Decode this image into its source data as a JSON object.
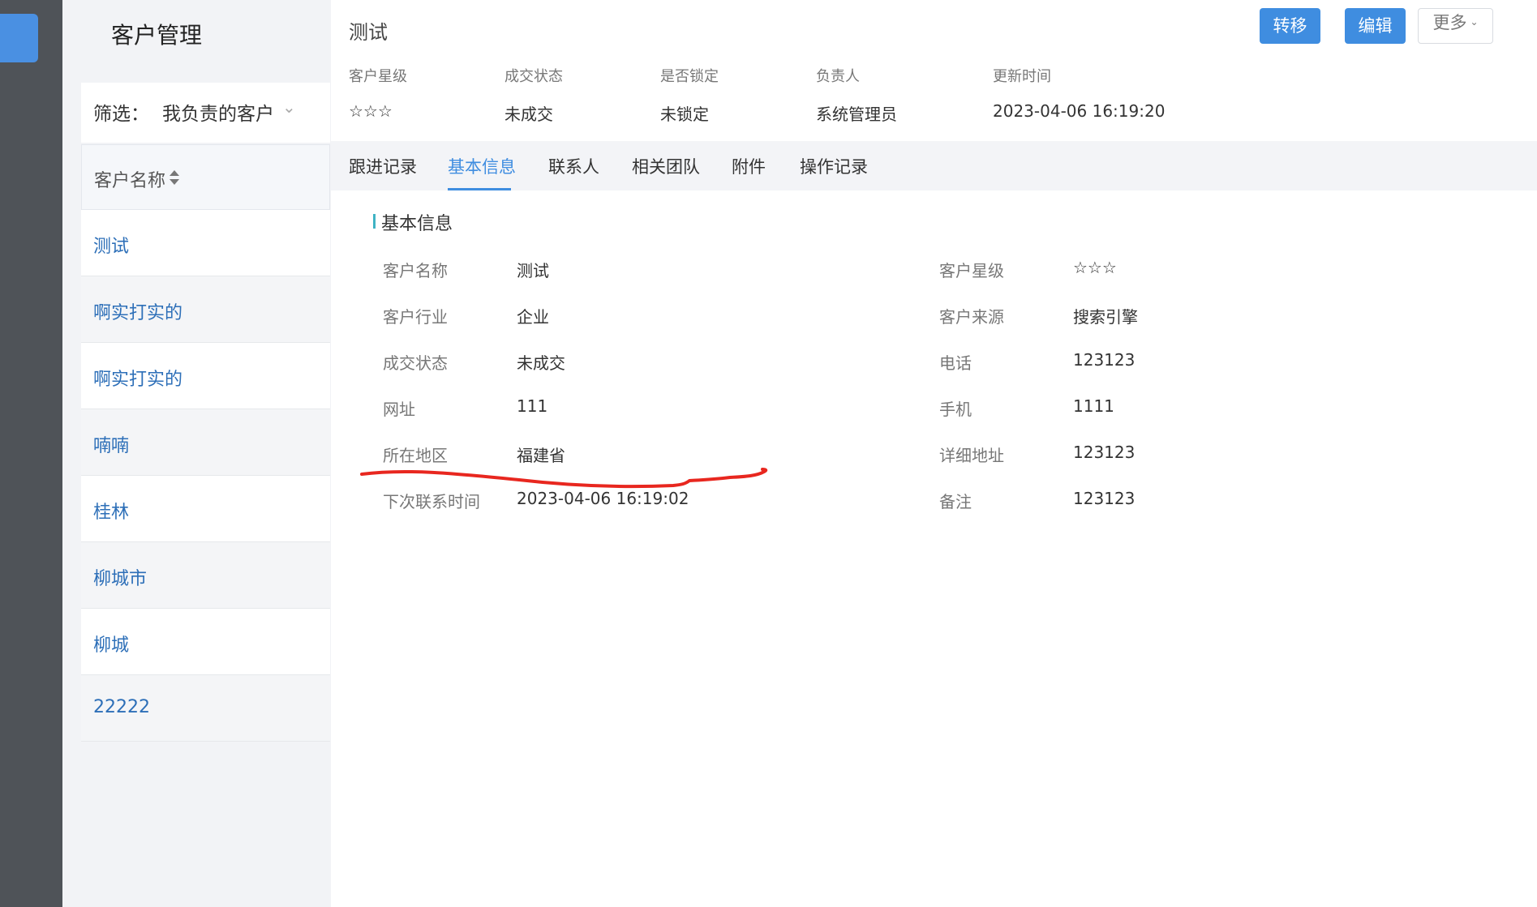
{
  "list_panel": {
    "title": "客户管理",
    "filter": {
      "label": "筛选：",
      "value": "我负责的客户"
    },
    "column_header": "客户名称",
    "rows": [
      "测试",
      "啊实打实的",
      "啊实打实的",
      "喃喃",
      "桂林",
      "柳城市",
      "柳城",
      "22222"
    ]
  },
  "header": {
    "customer_name": "测试",
    "buttons": {
      "transfer": "转移",
      "edit": "编辑",
      "more": "更多"
    }
  },
  "summary": [
    {
      "label": "客户星级",
      "value": "☆☆☆"
    },
    {
      "label": "成交状态",
      "value": "未成交"
    },
    {
      "label": "是否锁定",
      "value": "未锁定"
    },
    {
      "label": "负责人",
      "value": "系统管理员"
    },
    {
      "label": "更新时间",
      "value": "2023-04-06 16:19:20"
    }
  ],
  "tabs": [
    "跟进记录",
    "基本信息",
    "联系人",
    "相关团队",
    "附件",
    "操作记录"
  ],
  "active_tab": "基本信息",
  "section": {
    "title": "基本信息",
    "left_fields": [
      {
        "label": "客户名称",
        "value": "测试"
      },
      {
        "label": "客户行业",
        "value": "企业"
      },
      {
        "label": "成交状态",
        "value": "未成交"
      },
      {
        "label": "网址",
        "value": "111"
      },
      {
        "label": "所在地区",
        "value": "福建省"
      },
      {
        "label": "下次联系时间",
        "value": "2023-04-06 16:19:02"
      }
    ],
    "right_fields": [
      {
        "label": "客户星级",
        "value": "☆☆☆"
      },
      {
        "label": "客户来源",
        "value": "搜索引擎"
      },
      {
        "label": "电话",
        "value": "123123"
      },
      {
        "label": "手机",
        "value": "1111"
      },
      {
        "label": "详细地址",
        "value": "123123"
      },
      {
        "label": "备注",
        "value": "123123"
      }
    ]
  },
  "colors": {
    "accent": "#3f8de0",
    "link": "#2d6fb8",
    "sidebar_dark": "#4f5358",
    "annotation": "#e8271f"
  }
}
